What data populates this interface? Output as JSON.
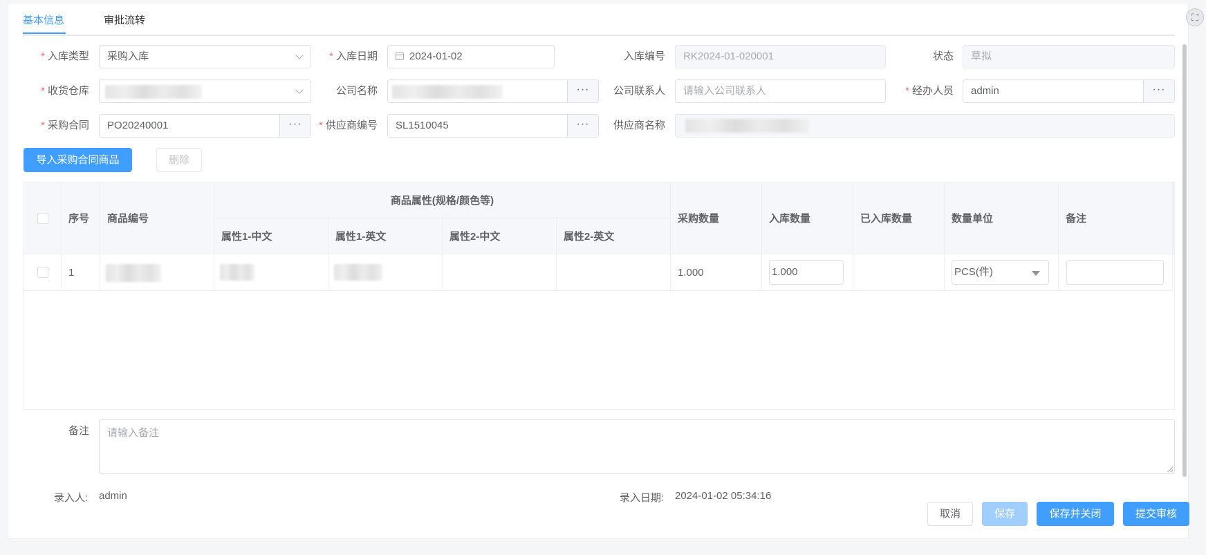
{
  "tabs": [
    {
      "label": "基本信息",
      "active": true
    },
    {
      "label": "审批流转",
      "active": false
    }
  ],
  "form": {
    "inbound_type": {
      "label": "入库类型",
      "value": "采购入库"
    },
    "inbound_date": {
      "label": "入库日期",
      "value": "2024-01-02"
    },
    "inbound_no": {
      "label": "入库编号",
      "value": "RK2024-01-020001"
    },
    "status": {
      "label": "状态",
      "value": "草拟"
    },
    "warehouse": {
      "label": "收货仓库",
      "value": ""
    },
    "company_name": {
      "label": "公司名称",
      "value": ""
    },
    "company_contact": {
      "label": "公司联系人",
      "placeholder": "请输入公司联系人"
    },
    "handler": {
      "label": "经办人员",
      "value": "admin"
    },
    "purchase_contract": {
      "label": "采购合同",
      "value": "PO20240001"
    },
    "supplier_code": {
      "label": "供应商编号",
      "value": "SL1510045"
    },
    "supplier_name": {
      "label": "供应商名称",
      "value": ""
    },
    "append_icon": "···"
  },
  "actions": {
    "import_label": "导入采购合同商品",
    "delete_label": "删除"
  },
  "table": {
    "headers": {
      "seq": "序号",
      "code": "商品编号",
      "attr_group": "商品属性(规格/颜色等)",
      "attr1_cn": "属性1-中文",
      "attr1_en": "属性1-英文",
      "attr2_cn": "属性2-中文",
      "attr2_en": "属性2-英文",
      "purchase_qty": "采购数量",
      "inbound_qty": "入库数量",
      "received_qty": "已入库数量",
      "unit": "数量单位",
      "remark": "备注"
    },
    "rows": [
      {
        "seq": "1",
        "purchase_qty": "1.000",
        "inbound_qty": "1.000",
        "unit": "PCS(件)",
        "remark": ""
      }
    ]
  },
  "remark": {
    "label": "备注",
    "placeholder": "请输入备注"
  },
  "meta": {
    "creator_label": "录入人:",
    "creator": "admin",
    "date_label": "录入日期:",
    "date": "2024-01-02 05:34:16"
  },
  "footer": {
    "cancel": "取消",
    "save": "保存",
    "save_close": "保存并关闭",
    "submit": "提交审核"
  },
  "colors": {
    "primary": "#409eff",
    "required": "#f56c6c"
  }
}
